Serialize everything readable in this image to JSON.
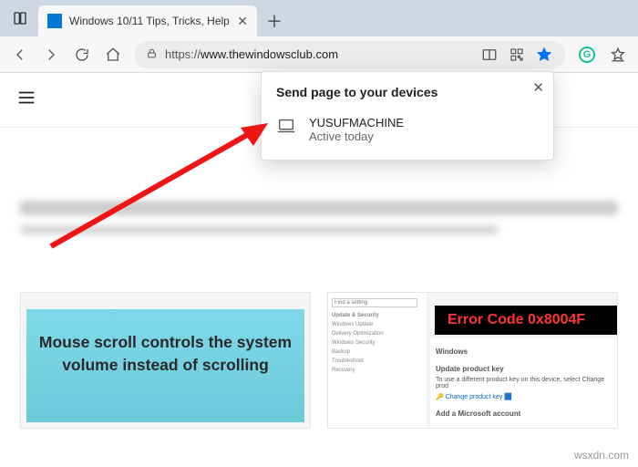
{
  "tab": {
    "title": "Windows 10/11 Tips, Tricks, Help"
  },
  "address": {
    "protocol": "https://",
    "host": "www.thewindowsclub.com"
  },
  "popup": {
    "title": "Send page to your devices",
    "device": {
      "name": "YUSUFMACHINE",
      "status": "Active today"
    }
  },
  "cards": {
    "left": "Mouse scroll controls the system volume instead of scrolling",
    "right": {
      "error": "Error Code 0x8004F",
      "sidebar_title": "Update & Security",
      "search_placeholder": "Find a setting",
      "items": [
        "Windows Update",
        "Delivery Optimization",
        "Windows Security",
        "Backup",
        "Troubleshoot",
        "Recovery"
      ],
      "main_heading": "Windows",
      "sub1": "Update product key",
      "sub1_desc": "To use a different product key on this device, select Change prod",
      "link": "Change product key",
      "sub2": "Add a Microsoft account"
    }
  },
  "watermark": "wsxdn.com"
}
